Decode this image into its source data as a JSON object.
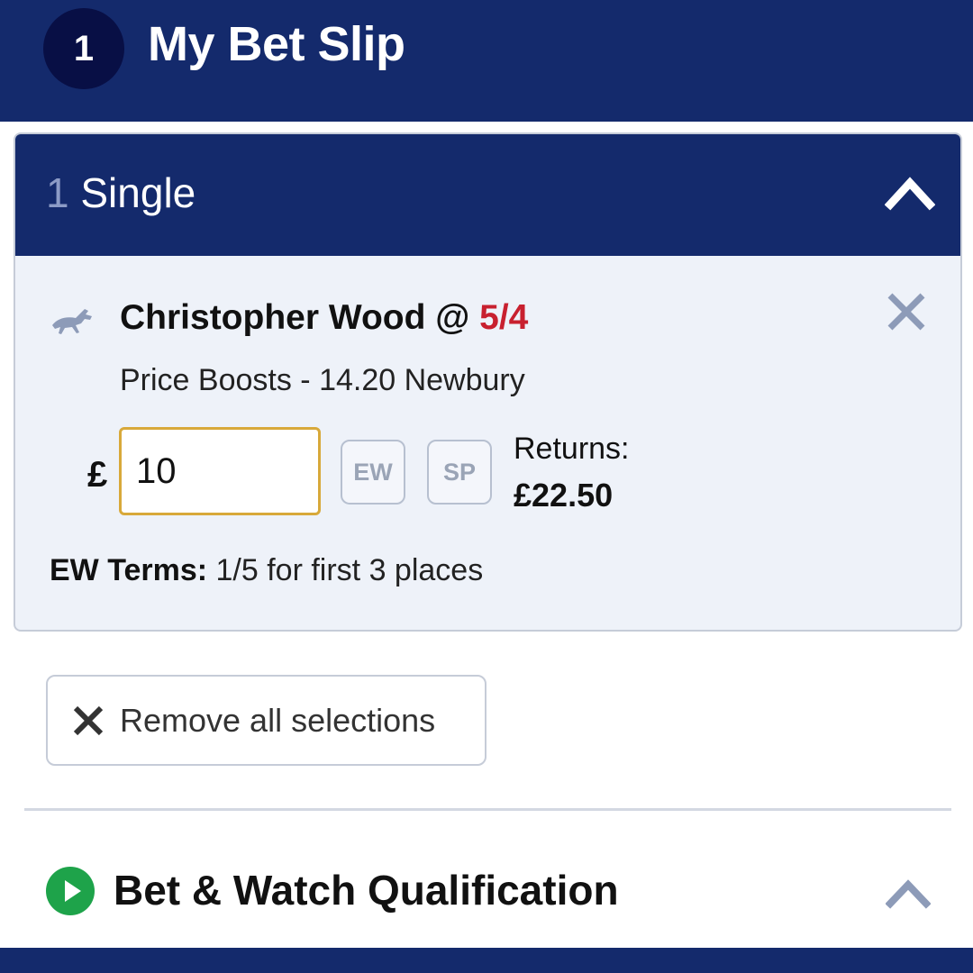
{
  "header": {
    "count": "1",
    "title": "My Bet Slip"
  },
  "single": {
    "count": "1",
    "label": " Single",
    "selection": {
      "name": "Christopher Wood @ ",
      "odds": "5/4",
      "event": "Price Boosts - 14.20 Newbury",
      "currency": "£",
      "stake_value": "10",
      "ew_label": "EW",
      "sp_label": "SP",
      "returns_label": "Returns:",
      "returns_value": "£22.50",
      "terms_label": "EW Terms:",
      "terms_text": " 1/5 for first 3 places"
    }
  },
  "remove_all_label": "Remove all selections",
  "bet_watch": {
    "title": "Bet & Watch Qualification"
  },
  "icons": {
    "horse": "horse-racing-icon",
    "close": "close-icon",
    "collapse": "chevron-up-icon",
    "play": "play-icon"
  },
  "colors": {
    "brand_navy": "#142a6c",
    "odds_red": "#c8202f",
    "input_focus": "#d8a93a",
    "play_green": "#1ea34a"
  }
}
